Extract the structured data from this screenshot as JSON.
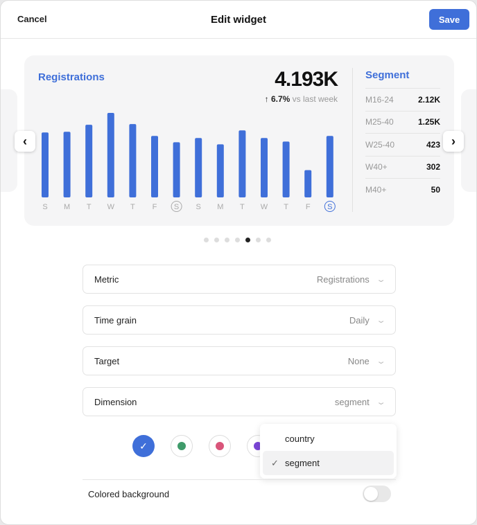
{
  "header": {
    "cancel": "Cancel",
    "title": "Edit widget",
    "save": "Save"
  },
  "widget": {
    "title": "Registrations",
    "value": "4.193K",
    "delta": "6.7%",
    "delta_suffix": "vs last week",
    "delta_direction": "up",
    "accent": "#3f6fd9",
    "chart_data": {
      "type": "bar",
      "categories": [
        "S",
        "M",
        "T",
        "W",
        "T",
        "F",
        "S",
        "S",
        "M",
        "T",
        "W",
        "T",
        "F",
        "S"
      ],
      "values": [
        93,
        94,
        104,
        121,
        105,
        88,
        79,
        85,
        76,
        96,
        85,
        80,
        39,
        88
      ],
      "highlighted": [
        6,
        13
      ]
    },
    "segment": {
      "title": "Segment",
      "rows": [
        {
          "k": "M16-24",
          "v": "2.12K"
        },
        {
          "k": "M25-40",
          "v": "1.25K"
        },
        {
          "k": "W25-40",
          "v": "423"
        },
        {
          "k": "W40+",
          "v": "302"
        },
        {
          "k": "M40+",
          "v": "50"
        }
      ]
    }
  },
  "carousel": {
    "pages": 7,
    "active": 4
  },
  "form": [
    {
      "label": "Metric",
      "value": "Registrations"
    },
    {
      "label": "Time grain",
      "value": "Daily"
    },
    {
      "label": "Target",
      "value": "None"
    },
    {
      "label": "Dimension",
      "value": "segment"
    }
  ],
  "colors": [
    "#3f6fd9",
    "#3f9b6a",
    "#d9557a",
    "#7a45d6"
  ],
  "dropdown": {
    "options": [
      "country",
      "segment"
    ],
    "selected": "segment"
  },
  "colored_background": {
    "label": "Colored background",
    "on": false
  }
}
